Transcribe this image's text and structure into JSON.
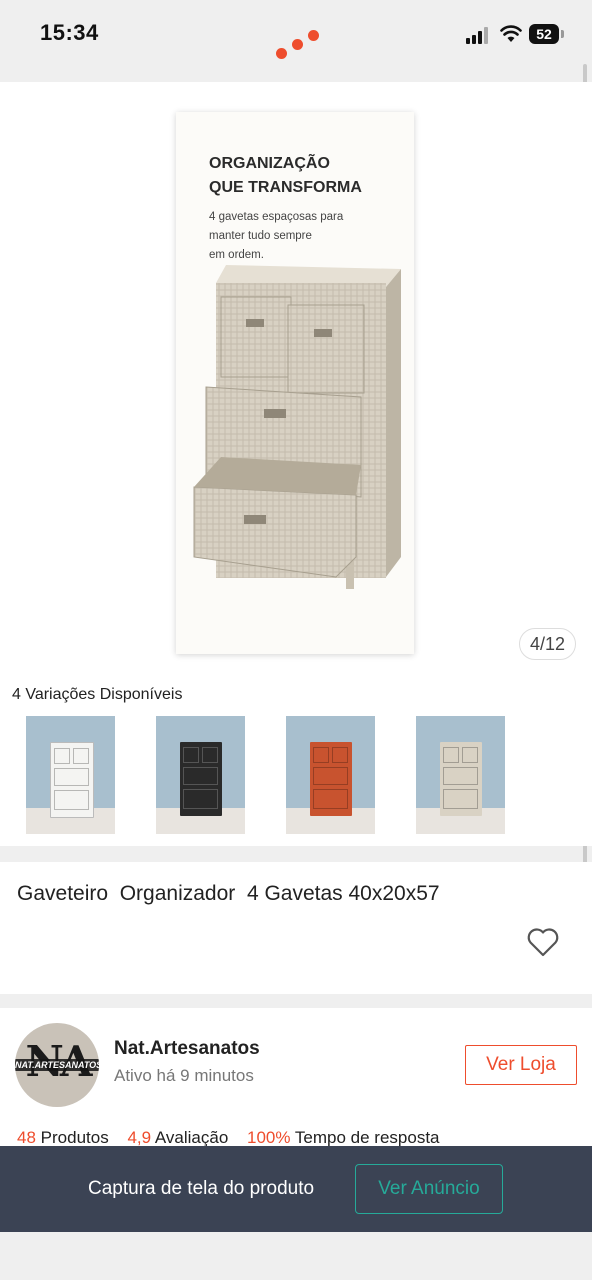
{
  "status_bar": {
    "time": "15:34",
    "battery": "52"
  },
  "gallery": {
    "promo_title_line1": "ORGANIZAÇÃO",
    "promo_title_line2": "QUE TRANSFORMA",
    "promo_subtitle_line1": "4 gavetas espaçosas para",
    "promo_subtitle_line2": "manter tudo sempre",
    "promo_subtitle_line3": "em ordem.",
    "counter": "4/12"
  },
  "variations": {
    "title": "4 Variações Disponíveis",
    "items": [
      {
        "color": "#f4f4f2"
      },
      {
        "color": "#2a2a2a"
      },
      {
        "color": "#c8532f"
      },
      {
        "color": "#d9d2c4"
      }
    ]
  },
  "product": {
    "title": "Gaveteiro  Organizador  4 Gavetas 40x20x57"
  },
  "shop": {
    "avatar_letters": "NA",
    "avatar_text": "NAT.ARTESANATOS",
    "name": "Nat.Artesanatos",
    "status": "Ativo há 9 minutos",
    "visit_label": "Ver Loja",
    "stats": {
      "products_value": "48",
      "products_label": "Produtos",
      "rating_value": "4,9",
      "rating_label": "Avaliação",
      "response_value": "100%",
      "response_label": "Tempo de resposta"
    }
  },
  "banner": {
    "text": "Captura de tela do produto",
    "button_label": "Ver Anúncio"
  },
  "colors": {
    "accent": "#ee4d2d",
    "teal": "#26aa99",
    "banner_bg": "#3b4354"
  }
}
